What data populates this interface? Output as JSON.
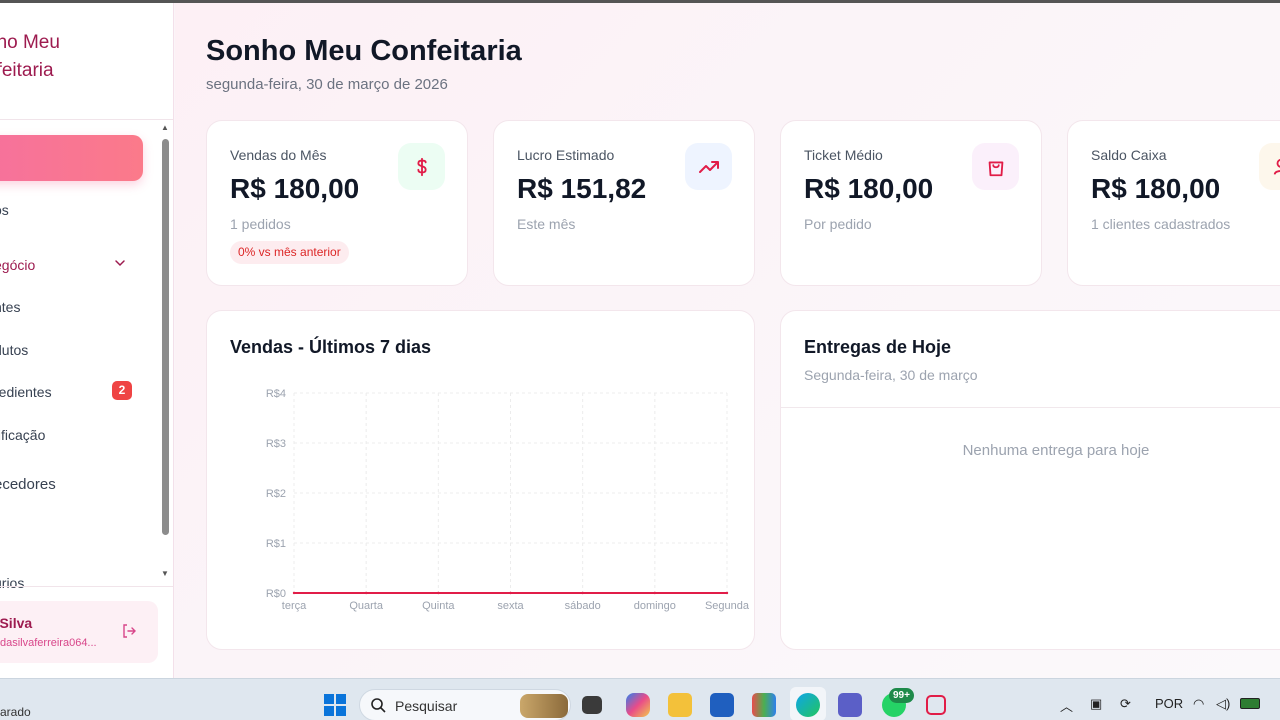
{
  "sidebar": {
    "brand_line1": "nho Meu",
    "brand_line2": "nfeitaria",
    "items": [
      {
        "label": "os"
      },
      {
        "label": "egócio"
      },
      {
        "label": "ntes"
      },
      {
        "label": "dutos"
      },
      {
        "label": "redientes",
        "badge": "2"
      },
      {
        "label": "tificação"
      },
      {
        "label": "ecedores"
      },
      {
        "label": "urios"
      }
    ],
    "user": {
      "name": "as Silva",
      "email": "dasilvaferreira064..."
    }
  },
  "header": {
    "title": "Sonho Meu Confeitaria",
    "date": "segunda-feira, 30 de março de 2026"
  },
  "cards": [
    {
      "label": "Vendas do Mês",
      "value": "R$ 180,00",
      "sub": "1 pedidos",
      "pill": "0% vs mês anterior",
      "icon": "dollar-icon"
    },
    {
      "label": "Lucro Estimado",
      "value": "R$ 151,82",
      "sub": "Este mês",
      "icon": "trending-up-icon"
    },
    {
      "label": "Ticket Médio",
      "value": "R$ 180,00",
      "sub": "Por pedido",
      "icon": "shopping-bag-icon"
    },
    {
      "label": "Saldo Caixa",
      "value": "R$ 180,00",
      "sub": "1 clientes cadastrados",
      "icon": "users-icon"
    }
  ],
  "sales_panel": {
    "title": "Vendas - Últimos 7 dias"
  },
  "chart_data": {
    "type": "line",
    "categories": [
      "terça",
      "Quarta",
      "Quinta",
      "sexta",
      "sábado",
      "domingo",
      "Segunda"
    ],
    "series": [
      {
        "values": [
          0,
          0,
          0,
          0,
          0,
          0,
          0
        ]
      }
    ],
    "yticks": [
      "R$0",
      "R$1",
      "R$2",
      "R$3",
      "R$4"
    ],
    "ylim": [
      0,
      4
    ],
    "grid": true,
    "color": "#e11d48"
  },
  "deliveries_panel": {
    "title": "Entregas de Hoje",
    "subtitle": "Segunda-feira, 30 de março",
    "empty": "Nenhuma entrega para hoje"
  },
  "taskbar": {
    "left_text": "arado",
    "search_placeholder": "Pesquisar",
    "notif_badge": "99+",
    "lang": "POR"
  },
  "colors": {
    "accent": "#f6719d",
    "brand": "#9d1b4f",
    "danger": "#ef4444"
  }
}
